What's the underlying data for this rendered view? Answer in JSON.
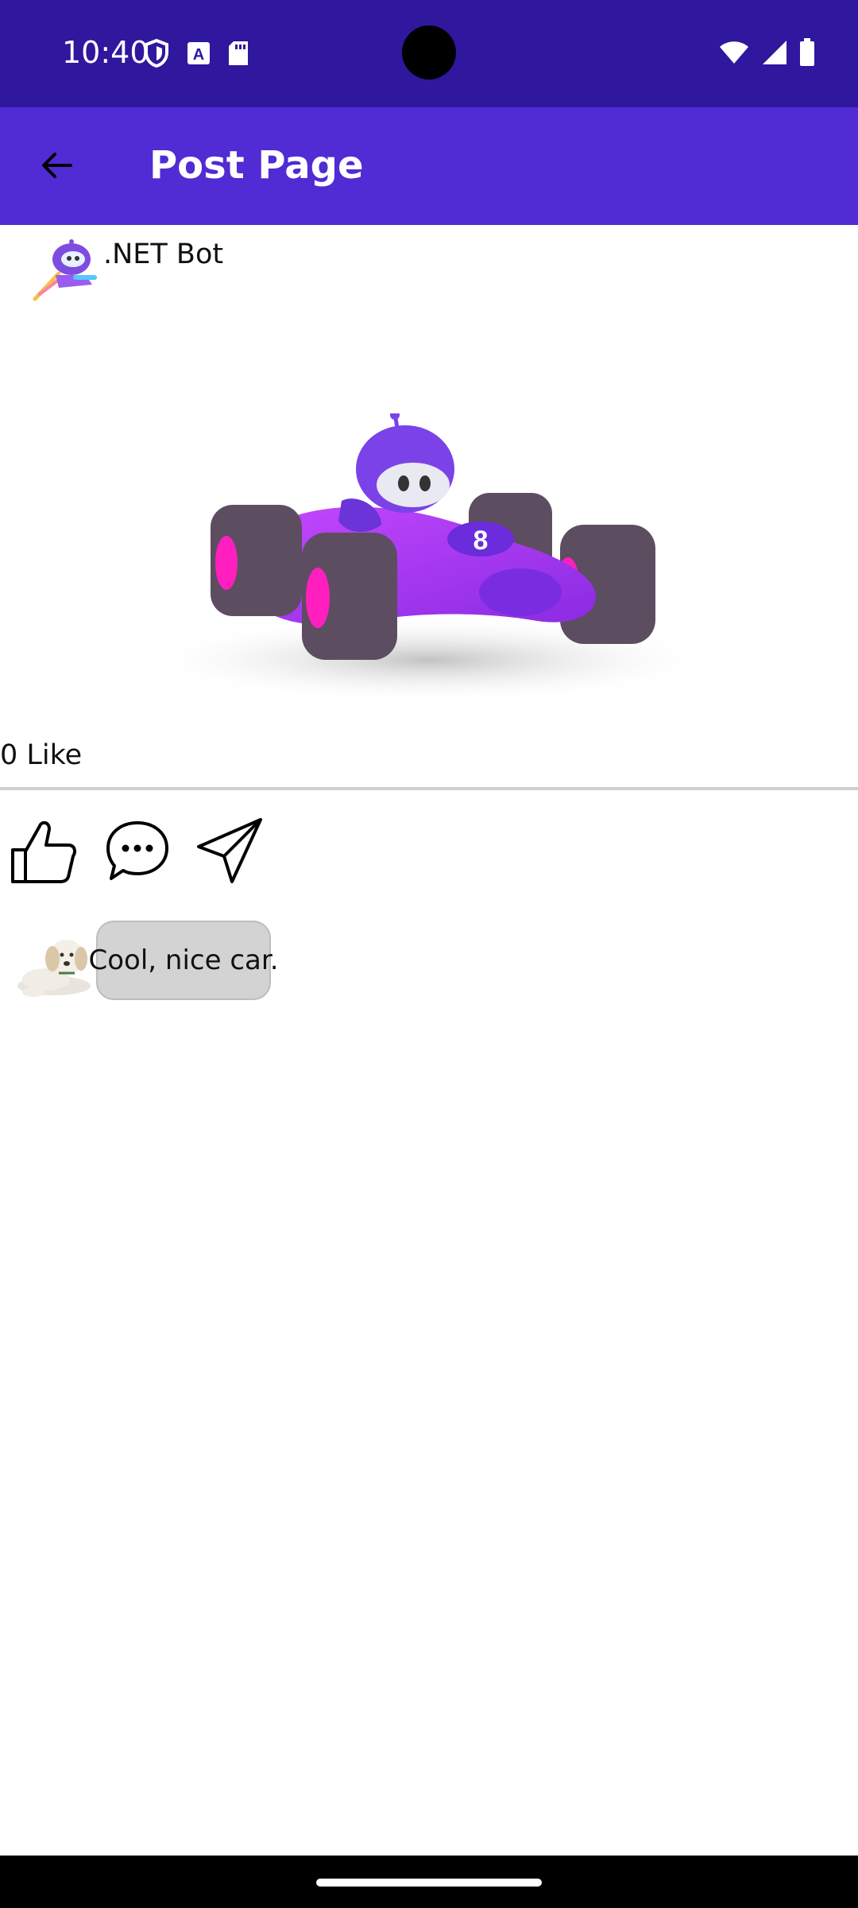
{
  "status_bar": {
    "time": "10:40",
    "left_icons": [
      "shield-icon",
      "font-a-icon",
      "sd-card-icon"
    ],
    "right_icons": [
      "wifi-icon",
      "cell-signal-icon",
      "battery-icon"
    ]
  },
  "app_bar": {
    "title": "Post Page",
    "back_icon": "arrow-left-icon"
  },
  "post": {
    "author_name": ".NET Bot",
    "image_description_icon": "race-car-bot-image",
    "like_count": "0 Like"
  },
  "actions": {
    "like_icon": "thumbs-up-icon",
    "comment_icon": "chat-bubble-icon",
    "share_icon": "send-icon"
  },
  "comments": [
    {
      "text": "Cool, nice car.",
      "avatar": "puppy-avatar"
    }
  ],
  "colors": {
    "status_bar": "#2f179e",
    "app_bar": "#512bd4",
    "comment_bubble": "#d3d3d3"
  }
}
